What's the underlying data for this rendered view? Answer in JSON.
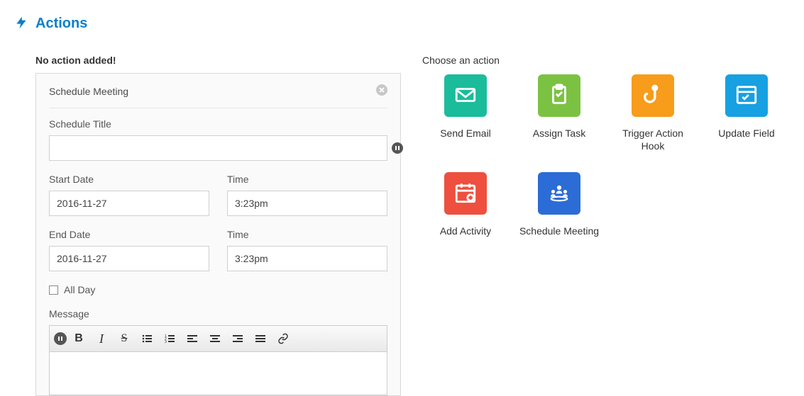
{
  "header": {
    "title": "Actions"
  },
  "left": {
    "no_action": "No action added!",
    "card_title": "Schedule Meeting",
    "title_label": "Schedule Title",
    "title_value": "",
    "start_date_label": "Start Date",
    "start_date_value": "2016-11-27",
    "start_time_label": "Time",
    "start_time_value": "3:23pm",
    "end_date_label": "End Date",
    "end_date_value": "2016-11-27",
    "end_time_label": "Time",
    "end_time_value": "3:23pm",
    "all_day_label": "All Day",
    "message_label": "Message"
  },
  "right": {
    "choose_label": "Choose an action",
    "tiles": [
      {
        "label": "Send Email",
        "color": "#1abc9c"
      },
      {
        "label": "Assign Task",
        "color": "#7cc242"
      },
      {
        "label": "Trigger Action Hook",
        "color": "#f79c1b"
      },
      {
        "label": "Update Field",
        "color": "#17a0e2"
      },
      {
        "label": "Add Activity",
        "color": "#ee4f3e"
      },
      {
        "label": "Schedule Meeting",
        "color": "#2c6cd6"
      }
    ]
  }
}
